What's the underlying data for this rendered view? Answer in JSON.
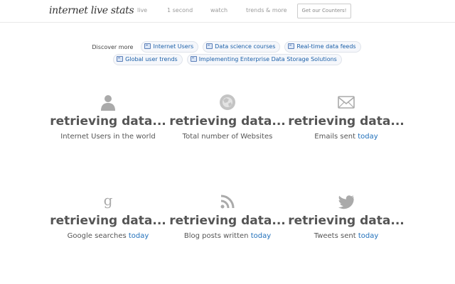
{
  "nav": {
    "logo": "internet live stats",
    "items": [
      "live",
      "1 second",
      "watch",
      "trends & more"
    ],
    "cta": "Get our Counters!"
  },
  "discover": {
    "label": "Discover more",
    "row1": [
      "Internet Users",
      "Data science courses",
      "Real-time data feeds"
    ],
    "row2": [
      "Global user trends",
      "Implementing Enterprise Data Storage Solutions"
    ]
  },
  "stats": [
    {
      "icon": "user-icon",
      "value": "retrieving data...",
      "caption": "Internet Users in the world",
      "suffix": ""
    },
    {
      "icon": "globe-icon",
      "value": "retrieving data...",
      "caption": "Total number of Websites",
      "suffix": ""
    },
    {
      "icon": "envelope-icon",
      "value": "retrieving data...",
      "caption": "Emails sent",
      "suffix": "today"
    },
    {
      "icon": "google-icon",
      "value": "retrieving data...",
      "caption": "Google searches",
      "suffix": "today"
    },
    {
      "icon": "rss-icon",
      "value": "retrieving data...",
      "caption": "Blog posts written",
      "suffix": "today"
    },
    {
      "icon": "twitter-icon",
      "value": "retrieving data...",
      "caption": "Tweets sent",
      "suffix": "today"
    }
  ],
  "colors": {
    "link": "#1f6fba",
    "icon": "#aaaaaa"
  }
}
